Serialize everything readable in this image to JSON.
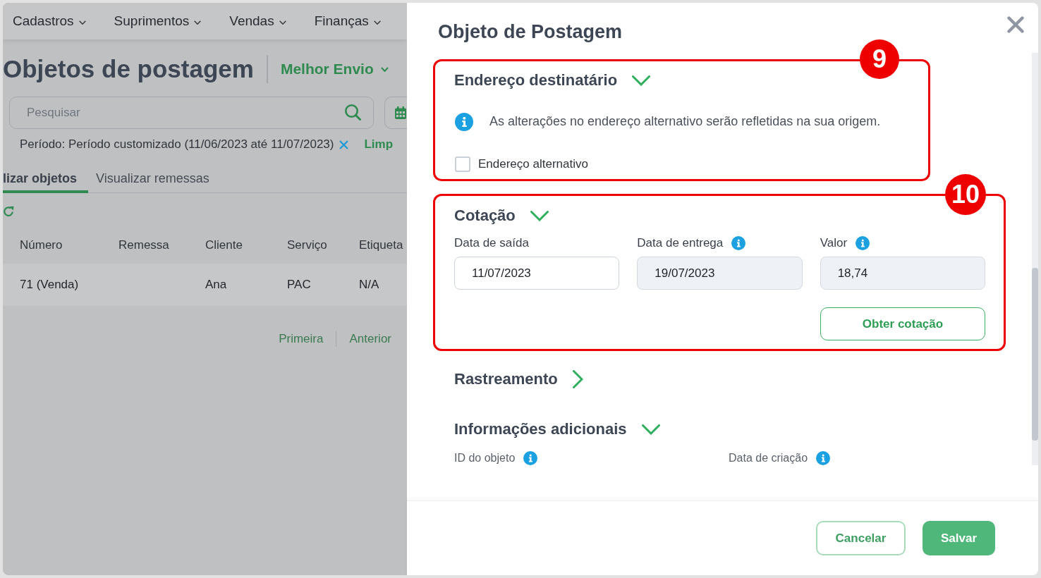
{
  "menu": [
    {
      "label": "Cadastros"
    },
    {
      "label": "Suprimentos"
    },
    {
      "label": "Vendas"
    },
    {
      "label": "Finanças"
    }
  ],
  "page": {
    "title": "Objetos de postagem",
    "integration": {
      "label": "Melhor Envio"
    },
    "search": {
      "placeholder": "Pesquisar"
    },
    "filter": {
      "text": "Período: Período customizado (11/06/2023 até 11/07/2023)",
      "clear_link": "Limp"
    },
    "tabs": [
      {
        "label": "lizar objetos",
        "selected": true
      },
      {
        "label": "Visualizar remessas",
        "selected": false
      }
    ],
    "table": {
      "columns": [
        "Número",
        "Remessa",
        "Cliente",
        "Serviço",
        "Etiqueta"
      ],
      "rows": [
        {
          "number": "71 (Venda)",
          "client": "Ana",
          "service": "PAC",
          "tag": "N/A"
        }
      ]
    },
    "pagination": [
      {
        "label": "Primeira",
        "disabled": true
      },
      {
        "label": "Anterior",
        "disabled": true
      }
    ]
  },
  "drawer": {
    "title": "Objeto de Postagem",
    "sections": [
      {
        "kind": "address",
        "title": "Endereço destinatário",
        "expanded": true,
        "callout": "9",
        "info": "As alterações no endereço alternativo serão refletidas na sua origem.",
        "checkbox": {
          "label": "Endereço alternativo",
          "checked": false
        }
      },
      {
        "kind": "quote",
        "title": "Cotação",
        "expanded": true,
        "callout": "10",
        "fields": [
          {
            "label": "Data de saída",
            "value": "11/07/2023",
            "info": false,
            "disabled": false
          },
          {
            "label": "Data de entrega",
            "value": "19/07/2023",
            "info": true,
            "disabled": true
          },
          {
            "label": "Valor",
            "value": "18,74",
            "info": true,
            "disabled": true
          }
        ],
        "button": "Obter cotação"
      },
      {
        "kind": "tracking",
        "title": "Rastreamento",
        "expanded": false
      },
      {
        "kind": "extra",
        "title": "Informações adicionais",
        "expanded": true,
        "fields": [
          {
            "label": "ID do objeto",
            "info": true
          },
          {
            "label": "Data de criação",
            "info": true
          }
        ]
      }
    ],
    "footer": {
      "buttons": [
        {
          "label": "Cancelar",
          "kind": "outline"
        },
        {
          "label": "Salvar",
          "kind": "primary"
        }
      ]
    }
  }
}
